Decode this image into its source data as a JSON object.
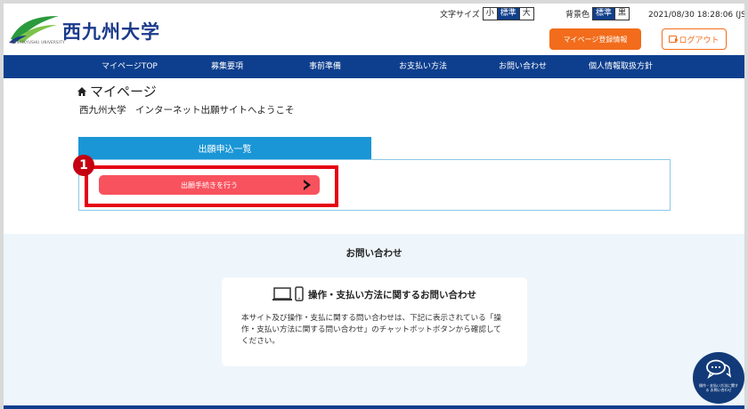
{
  "header": {
    "university_name": "西九州大学",
    "logo_subtitle": "NISHIKYUSHU UNIVERSITY",
    "font_size_label": "文字サイズ",
    "font_size_options": [
      "小",
      "標準",
      "大"
    ],
    "font_size_selected": "標準",
    "bg_color_label": "背景色",
    "bg_color_options": [
      "標準",
      "黒"
    ],
    "bg_color_selected": "標準",
    "datetime": "2021/08/30 18:28:06 (JST)",
    "register_label": "マイページ登録情報",
    "logout_label": "ログアウト"
  },
  "nav": {
    "items": [
      "マイページTOP",
      "募集要項",
      "事前準備",
      "お支払い方法",
      "お問い合わせ",
      "個人情報取扱方針"
    ]
  },
  "main": {
    "page_title": "マイページ",
    "welcome": "西九州大学　インターネット出願サイトへようこそ",
    "tab_label": "出願申込一覧",
    "apply_button": "出願手続きを行う",
    "step_badge": "1"
  },
  "contact": {
    "section_title": "お問い合わせ",
    "card_title": "操作・支払い方法に関するお問い合わせ",
    "card_body": "本サイト及び操作・支払に関する問い合わせは、下記に表示されている「操作・支払い方法に関する問い合わせ」のチャットボットボタンから確認してください。",
    "chat_button_text": "操作・支払い方法に関する お問い合わせ"
  },
  "colors": {
    "nav_bg": "#0e3f8e",
    "accent_orange": "#f26c1b",
    "tab_blue": "#1a96d6",
    "apply_red": "#f8525e",
    "highlight_red": "#e50012"
  },
  "icons": [
    "home-icon",
    "logout-icon",
    "arrow-right-icon",
    "laptop-icon",
    "smartphone-icon",
    "chat-icon"
  ]
}
